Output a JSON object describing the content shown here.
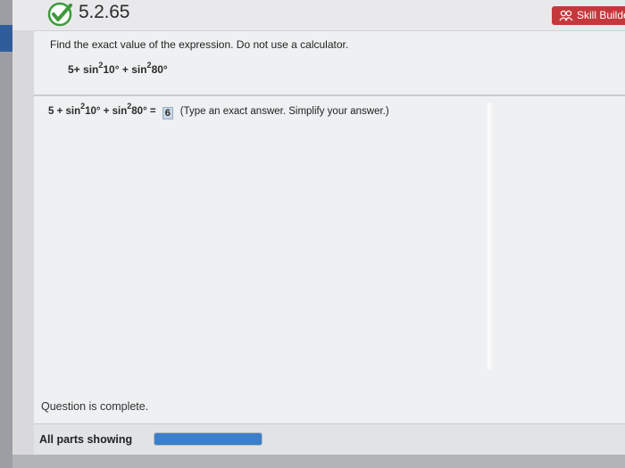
{
  "header": {
    "problem_number": "5.2.65",
    "skill_builder_label": "Skill Builder"
  },
  "question": {
    "instructions": "Find the exact value of the expression. Do not use a calculator.",
    "expression": {
      "prefix": "5+ sin",
      "exp1": "2",
      "arg1": "10°",
      "plus": " + sin",
      "exp2": "2",
      "arg2": "80°"
    }
  },
  "answer": {
    "prefix": "5 + sin",
    "exp1": "2",
    "arg1": "10°",
    "plus": " + sin",
    "exp2": "2",
    "arg2": "80°",
    "equals": " = ",
    "value": "6",
    "hint": "(Type an exact answer. Simplify your answer.)"
  },
  "status": {
    "complete_text": "Question is complete.",
    "parts_label": "All parts showing",
    "progress_fraction": 1.0
  },
  "colors": {
    "skill_builder_bg": "#c4383c",
    "progress": "#3a7fcb",
    "check": "#3c9a3a"
  }
}
